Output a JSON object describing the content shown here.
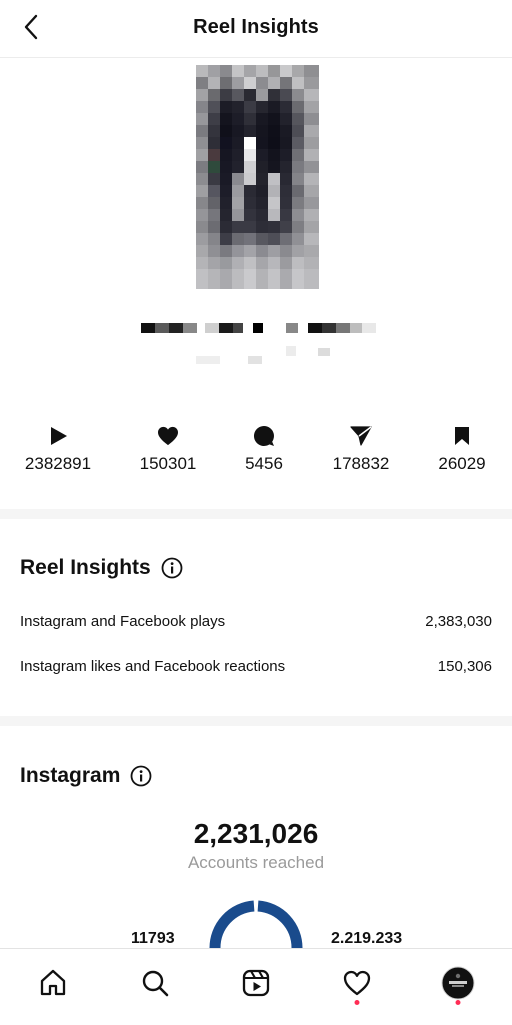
{
  "header": {
    "title": "Reel Insights",
    "back_icon": "chevron-left-icon"
  },
  "stats": [
    {
      "icon": "play-icon",
      "value": "2382891"
    },
    {
      "icon": "heart-icon",
      "value": "150301"
    },
    {
      "icon": "comment-icon",
      "value": "5456"
    },
    {
      "icon": "share-icon",
      "value": "178832"
    },
    {
      "icon": "bookmark-icon",
      "value": "26029"
    }
  ],
  "reel_insights": {
    "title": "Reel Insights",
    "rows": [
      {
        "label": "Instagram and Facebook plays",
        "value": "2,383,030"
      },
      {
        "label": "Instagram likes and Facebook reactions",
        "value": "150,306"
      }
    ]
  },
  "instagram": {
    "title": "Instagram",
    "accounts_reached": "2,231,026",
    "accounts_reached_label": "Accounts reached",
    "left_value": "11793",
    "right_value": "2.219.233",
    "ring_color": "#1a4b8c"
  },
  "nav": {
    "items": [
      "home-icon",
      "search-icon",
      "reels-icon",
      "activity-heart-icon",
      "profile-avatar"
    ],
    "notification_color": "#ff2d55"
  }
}
